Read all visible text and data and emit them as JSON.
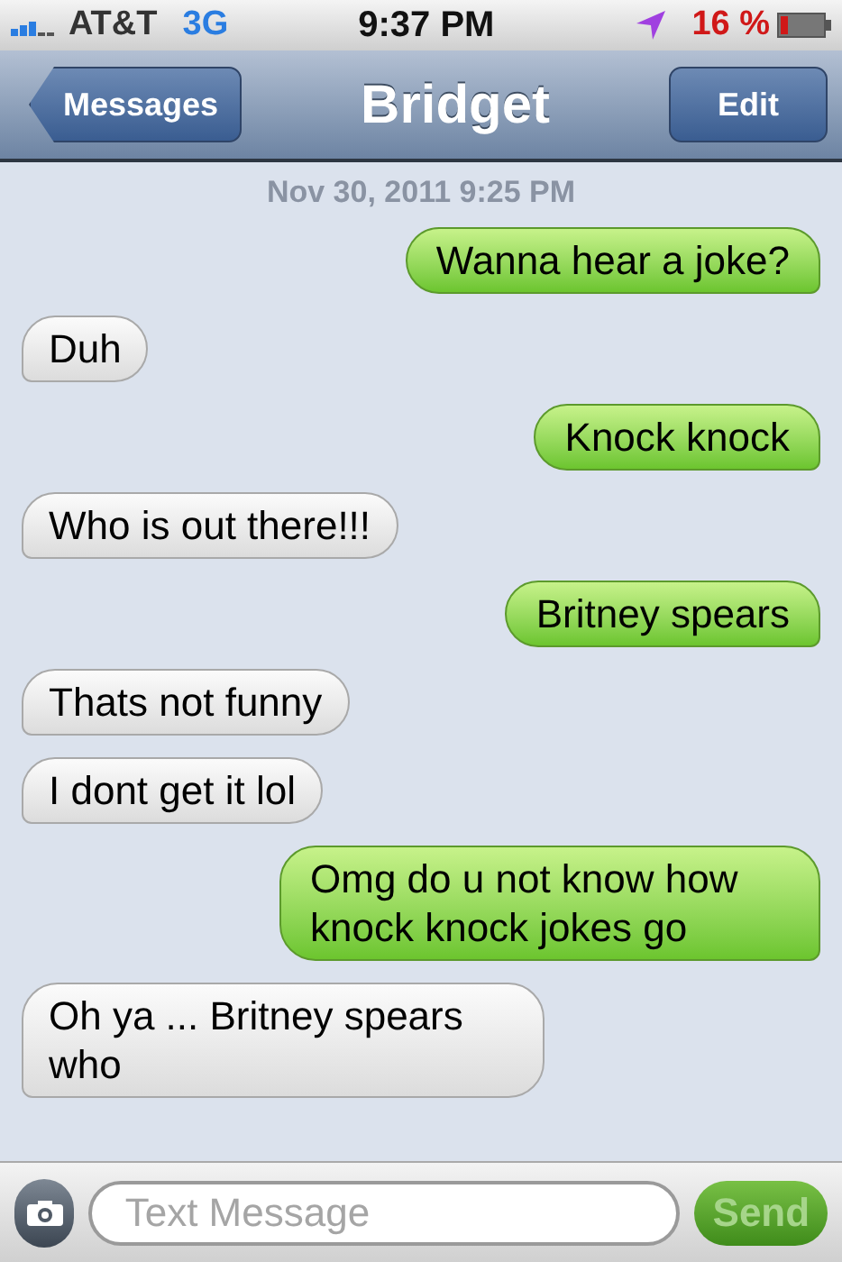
{
  "status_bar": {
    "carrier": "AT&T",
    "network": "3G",
    "time": "9:37 PM",
    "battery": "16 %"
  },
  "nav_bar": {
    "back": "Messages",
    "title": "Bridget",
    "edit": "Edit"
  },
  "timestamp": "Nov 30, 2011 9:25 PM",
  "messages": [
    {
      "kind": "sent",
      "text": "Wanna hear a joke?"
    },
    {
      "kind": "received",
      "text": "Duh"
    },
    {
      "kind": "sent",
      "text": "Knock knock"
    },
    {
      "kind": "received",
      "text": "Who is out there!!!"
    },
    {
      "kind": "sent",
      "text": "Britney spears"
    },
    {
      "kind": "received",
      "text": "Thats not funny"
    },
    {
      "kind": "received",
      "text": "I dont get it lol"
    },
    {
      "kind": "sent",
      "text": "Omg do u not know how knock knock jokes go"
    },
    {
      "kind": "received",
      "text": "Oh ya ... Britney spears who"
    }
  ],
  "composer": {
    "placeholder": "Text Message",
    "send": "Send",
    "send_disabled": true
  }
}
